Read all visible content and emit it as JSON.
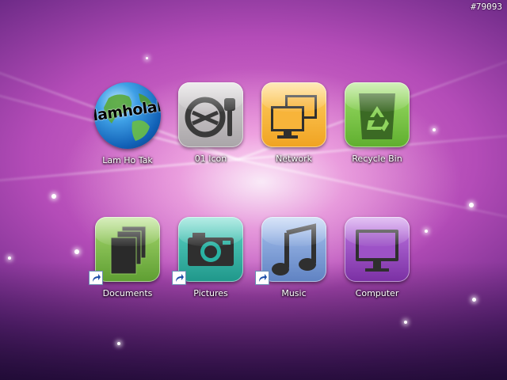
{
  "watermark": "#79093",
  "icons": [
    {
      "label": "Lam Ho Tak",
      "icon": "globe-icon",
      "globe_text": "lamholak"
    },
    {
      "label": "01 Icon",
      "icon": "face-utensils-icon"
    },
    {
      "label": "Network",
      "icon": "network-icon",
      "color": "#f0a321"
    },
    {
      "label": "Recycle Bin",
      "icon": "recycle-bin-icon",
      "color": "#5fae2e"
    },
    {
      "label": "Documents",
      "icon": "documents-icon",
      "color": "#6cae3d",
      "shortcut": true
    },
    {
      "label": "Pictures",
      "icon": "camera-icon",
      "color": "#25a79a",
      "shortcut": true
    },
    {
      "label": "Music",
      "icon": "music-note-icon",
      "color": "#6f8fc9",
      "shortcut": true
    },
    {
      "label": "Computer",
      "icon": "monitor-icon",
      "color": "#8f3fb5"
    }
  ]
}
